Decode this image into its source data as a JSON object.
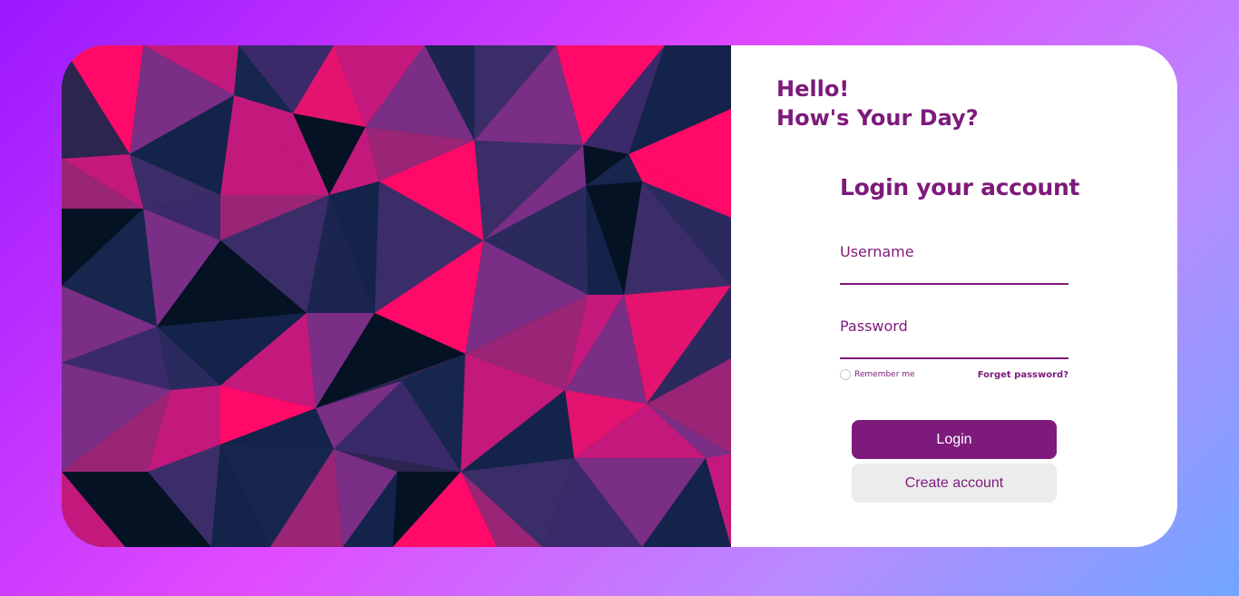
{
  "greeting": {
    "line1": "Hello!",
    "line2": "How's Your Day?"
  },
  "form": {
    "title": "Login your account",
    "username_label": "Username",
    "username_value": "",
    "password_label": "Password",
    "password_value": "",
    "remember_label": "Remember me",
    "remember_checked": false,
    "forgot_label": "Forget password?",
    "login_label": "Login",
    "create_label": "Create account"
  },
  "colors": {
    "accent": "#7d1a7b",
    "create_button_bg": "#ececec",
    "art_pink": "#ff0a68",
    "art_magenta": "#c4197c",
    "art_purple": "#7a2e85",
    "art_navy": "#13234a",
    "art_dark": "#041224"
  },
  "icons": {
    "art": "low-poly-triangles-image"
  }
}
